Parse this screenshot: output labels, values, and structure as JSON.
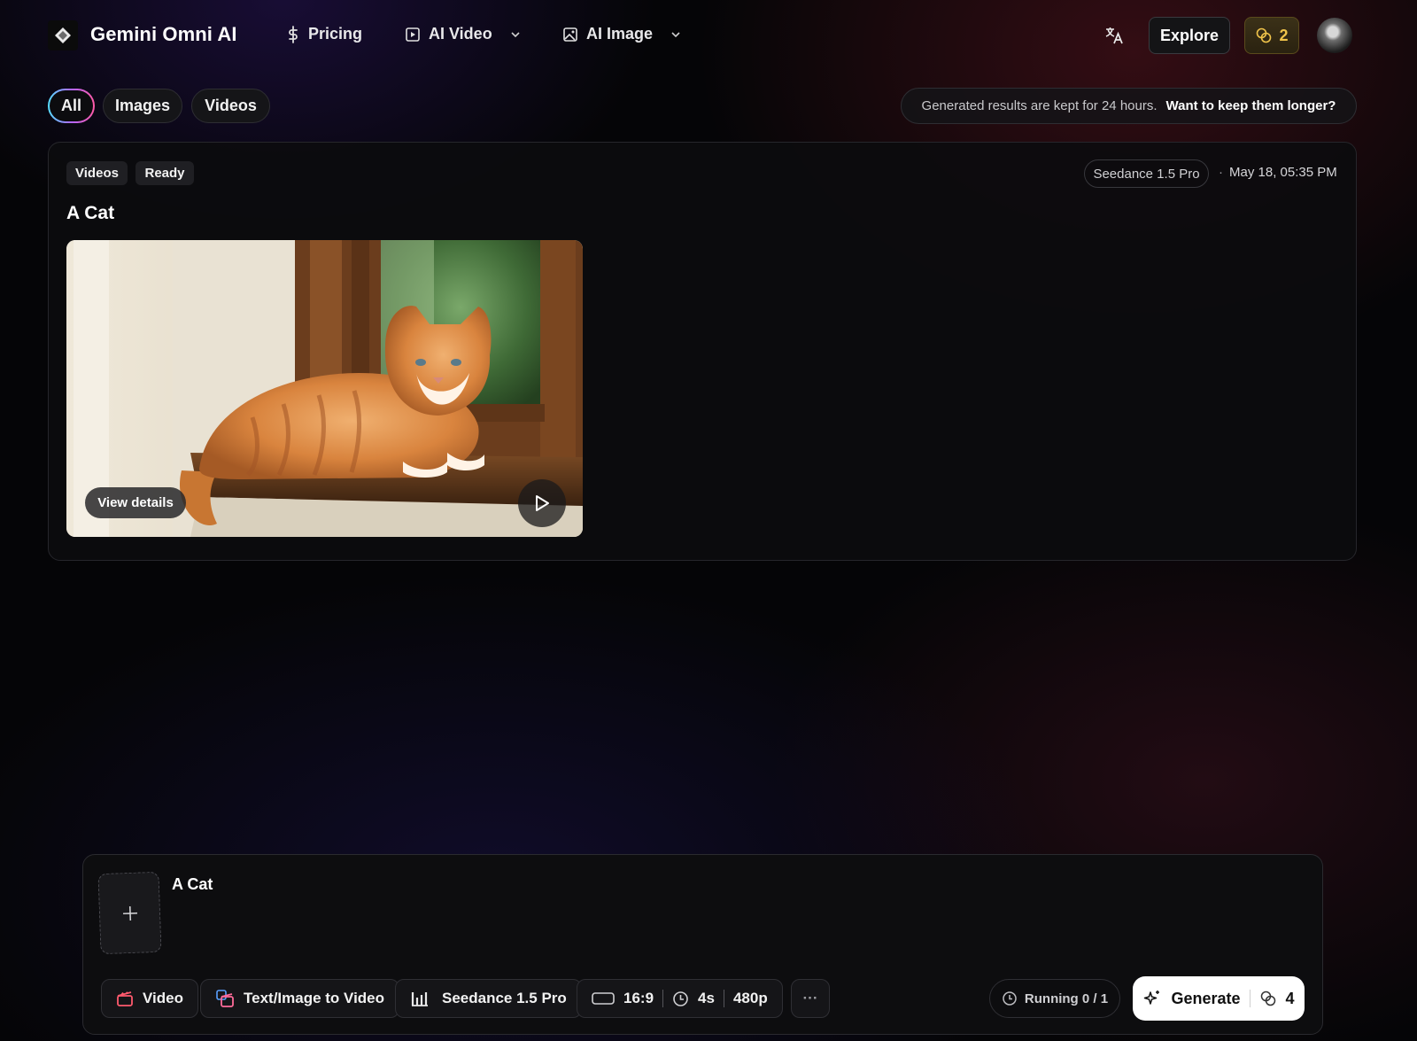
{
  "header": {
    "brand": "Gemini Omni AI",
    "nav": [
      {
        "label": "Pricing"
      },
      {
        "label": "AI Video"
      },
      {
        "label": "AI Image"
      }
    ],
    "explore_label": "Explore",
    "credits": "2"
  },
  "filters": {
    "tabs": [
      {
        "label": "All",
        "active": true
      },
      {
        "label": "Images"
      },
      {
        "label": "Videos"
      }
    ],
    "notice_text": "Generated results are kept for 24 hours.",
    "notice_link": "Want to keep them longer?"
  },
  "result": {
    "type_tag": "Videos",
    "status_tag": "Ready",
    "model": "Seedance 1.5 Pro",
    "separator": "·",
    "date": "May 18, 05:35 PM",
    "title": "A Cat",
    "view_details_label": "View details"
  },
  "composer": {
    "prompt": "A Cat",
    "mode_label": "Video",
    "workflow_label": "Text/Image to Video",
    "model_label": "Seedance 1.5 Pro",
    "aspect_ratio": "16:9",
    "duration": "4s",
    "resolution": "480p",
    "more_label": "···",
    "running_label": "Running 0 / 1",
    "generate_label": "Generate",
    "generate_cost": "4"
  },
  "colors": {
    "accent_gold": "#f0c44a",
    "mode_icon": "#ff5a6e",
    "workflow_icon": "#ff6b9a"
  },
  "icons": {
    "logo": "diamond-logo-icon",
    "pricing": "dollar-icon",
    "ai_video": "play-square-icon",
    "ai_image": "image-icon",
    "translate": "translate-icon",
    "credits": "coins-icon",
    "play": "play-icon",
    "add": "plus-icon",
    "clock": "clock-icon",
    "sparkle": "sparkle-icon"
  }
}
